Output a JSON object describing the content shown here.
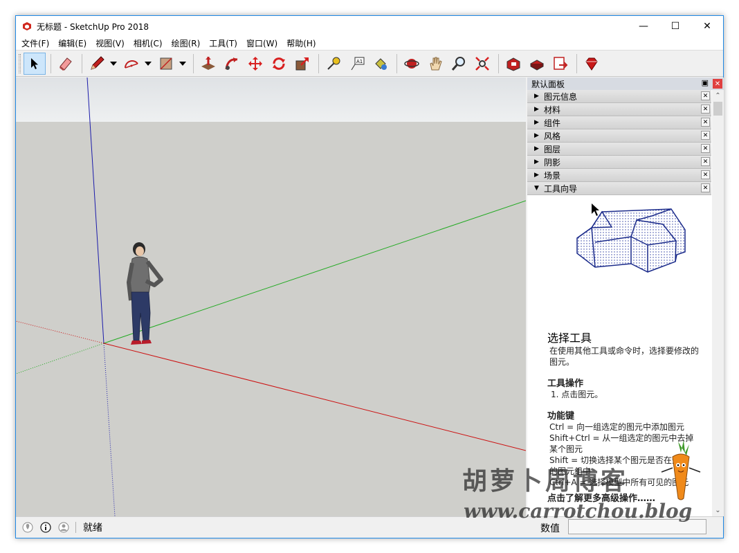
{
  "window": {
    "title": "无标题 - SketchUp Pro 2018"
  },
  "menu": [
    "文件(F)",
    "编辑(E)",
    "视图(V)",
    "相机(C)",
    "绘图(R)",
    "工具(T)",
    "窗口(W)",
    "帮助(H)"
  ],
  "panel": {
    "title": "默认面板",
    "trays": [
      {
        "label": "图元信息",
        "expanded": false
      },
      {
        "label": "材料",
        "expanded": false
      },
      {
        "label": "组件",
        "expanded": false
      },
      {
        "label": "风格",
        "expanded": false
      },
      {
        "label": "图层",
        "expanded": false
      },
      {
        "label": "阴影",
        "expanded": false
      },
      {
        "label": "场景",
        "expanded": false
      },
      {
        "label": "工具向导",
        "expanded": true
      }
    ],
    "guide": {
      "title": "选择工具",
      "description": "在使用其他工具或命令时，选择要修改的图元。",
      "ops_heading": "工具操作",
      "ops_step": "1. 点击图元。",
      "keys_heading": "功能键",
      "keys": [
        "Ctrl = 向一组选定的图元中添加图元",
        "Shift+Ctrl = 从一组选定的图元中去掉某个图元",
        "Shift = 切换选择某个图元是否在选定的图元组中",
        "Ctrl+A = 选择模型中所有可见的图元"
      ],
      "more_link": "点击了解更多高级操作……"
    }
  },
  "status": {
    "text": "就绪",
    "measure_label": "数值"
  },
  "watermark": {
    "cn": "胡萝卜周博客",
    "en": "www.carrotchou.blog"
  },
  "colors": {
    "accent": "#1e88e5",
    "axis_red": "#cc1111",
    "axis_green": "#22aa22",
    "axis_blue": "#1a1aaa",
    "sky": "#e6e8ea",
    "ground": "#cfcfcb"
  }
}
